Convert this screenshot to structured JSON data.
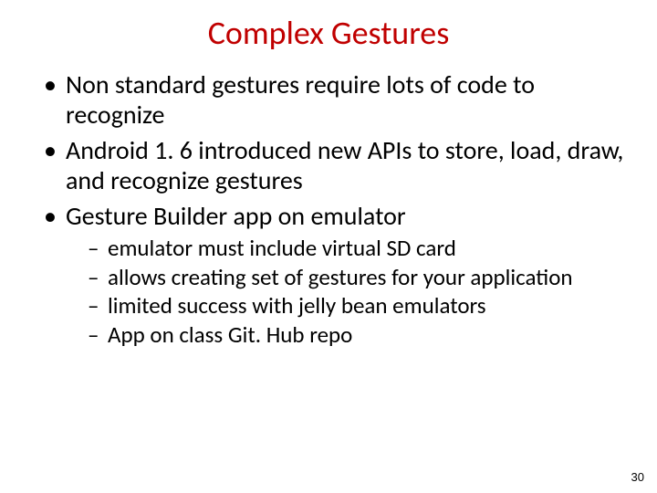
{
  "title": "Complex Gestures",
  "bullets": [
    {
      "text": "Non standard gestures require lots of code to recognize"
    },
    {
      "text": "Android 1. 6 introduced new APIs to store, load, draw, and recognize gestures"
    },
    {
      "text": "Gesture Builder app on emulator",
      "sub": [
        "emulator must include virtual SD card",
        "allows creating set of gestures for your application",
        "limited success with jelly bean emulators",
        "App on class Git. Hub repo"
      ]
    }
  ],
  "page_number": "30"
}
